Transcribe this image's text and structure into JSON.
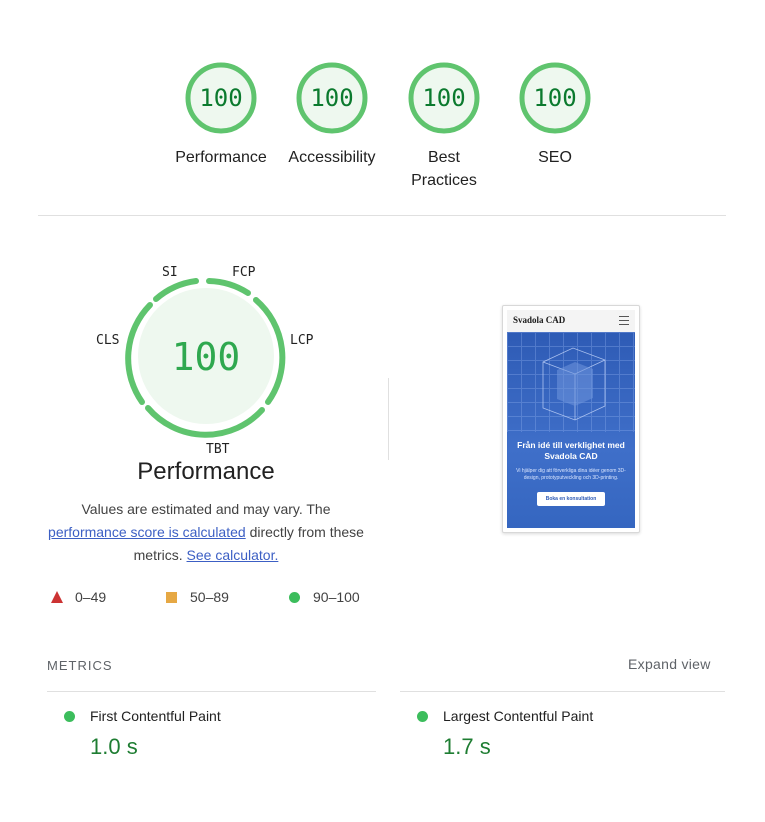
{
  "categories": [
    {
      "score": "100",
      "label": "Performance"
    },
    {
      "score": "100",
      "label": "Accessibility"
    },
    {
      "score": "100",
      "label": "Best Practices"
    },
    {
      "score": "100",
      "label": "SEO"
    }
  ],
  "performance": {
    "score": "100",
    "title": "Performance",
    "metric_labels": {
      "si": "SI",
      "fcp": "FCP",
      "lcp": "LCP",
      "tbt": "TBT",
      "cls": "CLS"
    },
    "desc_1": "Values are estimated and may vary. The",
    "desc_link": "performance score is calculated",
    "desc_2": "directly from these metrics.",
    "calc_link": "See calculator."
  },
  "legend": {
    "fail": "0–49",
    "average": "50–89",
    "pass": "90–100"
  },
  "screenshot": {
    "brand": "Svadola CAD",
    "headline": "Från idé till verklighet med Svadola CAD",
    "body": "Vi hjälper dig att förverkliga dina idéer genom 3D-design, prototyputveckling och 3D-printing.",
    "button": "Boka en konsultation"
  },
  "metrics": {
    "title": "METRICS",
    "expand": "Expand view",
    "items": [
      {
        "name": "First Contentful Paint",
        "value": "1.0 s"
      },
      {
        "name": "Largest Contentful Paint",
        "value": "1.7 s"
      }
    ]
  },
  "colors": {
    "pass_green": "#0cce6b",
    "pass_text": "#0b7a2e",
    "fail_red": "#cc3333",
    "average_orange": "#e6a844",
    "link_blue": "#3c5fc4"
  }
}
